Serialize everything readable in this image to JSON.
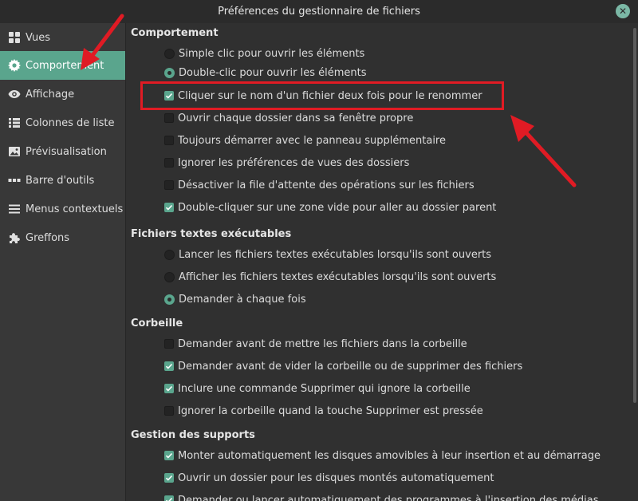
{
  "window": {
    "title": "Préférences du gestionnaire de fichiers",
    "close_glyph": "✕"
  },
  "sidebar": {
    "items": [
      {
        "label": "Vues",
        "icon": "grid-icon"
      },
      {
        "label": "Comportement",
        "icon": "gear-icon",
        "active": true
      },
      {
        "label": "Affichage",
        "icon": "eye-icon"
      },
      {
        "label": "Colonnes de liste",
        "icon": "list-columns-icon"
      },
      {
        "label": "Prévisualisation",
        "icon": "image-icon"
      },
      {
        "label": "Barre d'outils",
        "icon": "dots-icon"
      },
      {
        "label": "Menus contextuels",
        "icon": "menu-icon"
      },
      {
        "label": "Greffons",
        "icon": "puzzle-icon"
      }
    ]
  },
  "sections": {
    "behavior": {
      "title": "Comportement",
      "options": [
        {
          "type": "radio",
          "checked": false,
          "label": "Simple clic pour ouvrir les éléments"
        },
        {
          "type": "radio",
          "checked": true,
          "label": "Double-clic pour ouvrir les éléments"
        },
        {
          "type": "checkbox",
          "checked": true,
          "label": "Cliquer sur le nom d'un fichier deux fois pour le renommer"
        },
        {
          "type": "checkbox",
          "checked": false,
          "label": "Ouvrir chaque dossier dans sa fenêtre propre"
        },
        {
          "type": "checkbox",
          "checked": false,
          "label": "Toujours démarrer avec le panneau supplémentaire"
        },
        {
          "type": "checkbox",
          "checked": false,
          "label": "Ignorer les préférences de vues des dossiers"
        },
        {
          "type": "checkbox",
          "checked": false,
          "label": "Désactiver la file d'attente des opérations sur les fichiers"
        },
        {
          "type": "checkbox",
          "checked": true,
          "label": "Double-cliquer sur une zone vide pour aller au dossier parent"
        }
      ]
    },
    "executables": {
      "title": "Fichiers textes exécutables",
      "options": [
        {
          "type": "radio",
          "checked": false,
          "label": "Lancer les fichiers textes exécutables lorsqu'ils sont ouverts"
        },
        {
          "type": "radio",
          "checked": false,
          "label": "Afficher les fichiers textes exécutables lorsqu'ils sont ouverts"
        },
        {
          "type": "radio",
          "checked": true,
          "label": "Demander à chaque fois"
        }
      ]
    },
    "trash": {
      "title": "Corbeille",
      "options": [
        {
          "type": "checkbox",
          "checked": false,
          "label": "Demander avant de mettre les fichiers dans la corbeille"
        },
        {
          "type": "checkbox",
          "checked": true,
          "label": "Demander avant de vider la corbeille ou de supprimer des fichiers"
        },
        {
          "type": "checkbox",
          "checked": true,
          "label": "Inclure une commande Supprimer qui ignore la corbeille"
        },
        {
          "type": "checkbox",
          "checked": false,
          "label": "Ignorer la corbeille quand la touche Supprimer est pressée"
        }
      ]
    },
    "media": {
      "title": "Gestion des supports",
      "options": [
        {
          "type": "checkbox",
          "checked": true,
          "label": "Monter automatiquement les disques amovibles à leur insertion et au démarrage"
        },
        {
          "type": "checkbox",
          "checked": true,
          "label": "Ouvrir un dossier pour les disques montés automatiquement"
        },
        {
          "type": "checkbox",
          "checked": true,
          "label": "Demander ou lancer automatiquement des programmes à l'insertion des médias"
        }
      ]
    }
  },
  "colors": {
    "accent": "#5aa58d",
    "highlight": "#e01b24"
  }
}
